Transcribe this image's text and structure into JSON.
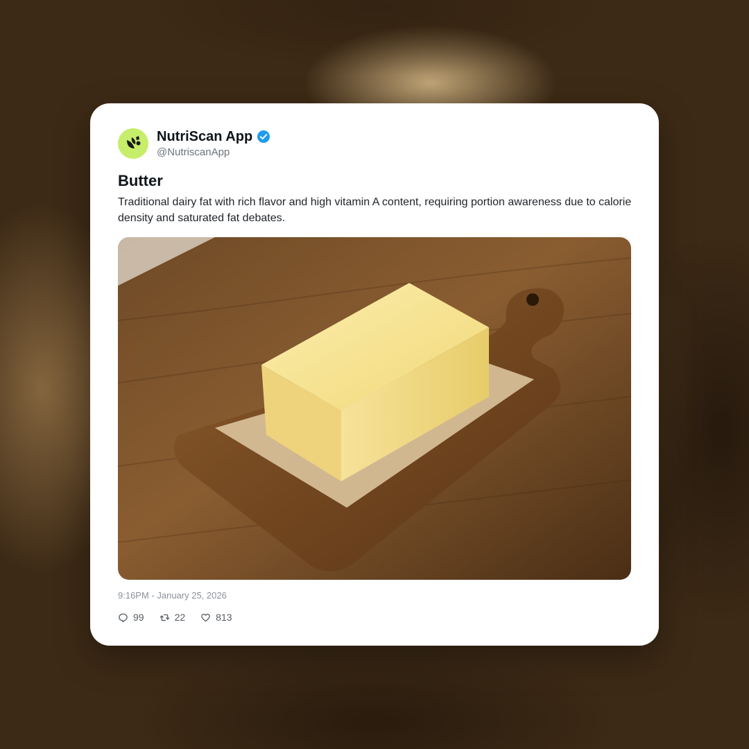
{
  "post": {
    "author_name": "NutriScan App",
    "handle": "@NutriscanApp",
    "title": "Butter",
    "description": "Traditional dairy fat with rich flavor and high vitamin A content, requiring portion awareness due to calorie density and saturated fat debates.",
    "timestamp": "9:16PM - January 25, 2026",
    "stats": {
      "replies": "99",
      "reposts": "22",
      "likes": "813"
    }
  },
  "icons": {
    "avatar": "leaf-logo-icon",
    "verified": "verified-badge-icon",
    "reply": "reply-icon",
    "repost": "repost-icon",
    "like": "heart-icon"
  },
  "colors": {
    "avatar_bg": "#c6ee6a",
    "verified": "#1d9bf0",
    "card_bg": "#ffffff"
  }
}
